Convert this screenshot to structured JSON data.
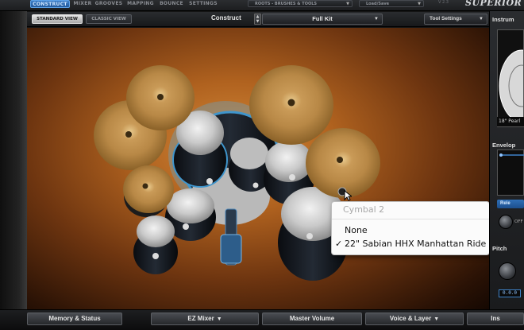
{
  "nav": {
    "tabs": [
      "CONSTRUCT",
      "MIXER",
      "GROOVES",
      "MAPPING",
      "BOUNCE",
      "SETTINGS"
    ],
    "presets_dropdown": "ROOTS - BRUSHES & TOOLS",
    "load_save": "Load/Save",
    "version": "V 2.3",
    "brand": "SUPERIOR"
  },
  "toolbar": {
    "view_tabs": [
      "STANDARD VIEW",
      "CLASSIC VIEW"
    ],
    "construct_label": "Construct",
    "kit_select": "Full Kit",
    "tool_settings": "Tool Settings"
  },
  "context_menu": {
    "title": "Cymbal 2",
    "items": [
      "None",
      "22\" Sabian HHX Manhattan Ride"
    ],
    "checked_index": 1,
    "check_mark": "✓"
  },
  "right_panel": {
    "instrument_header": "Instrum",
    "instrument_caption": "18\" Pearl",
    "envelope_header": "Envelop",
    "release_button": "Rele",
    "off_label": "OFF",
    "pitch_header": "Pitch",
    "pitch_value": "0.0.0"
  },
  "bottom_bar": {
    "tabs": [
      "Memory & Status",
      "EZ Mixer",
      "Master Volume",
      "Voice & Layer",
      "Ins"
    ],
    "arrow": "▼"
  },
  "colors": {
    "accent_blue": "#3d7fc9",
    "stage_wood": "#b0621f",
    "cymbal_bronze": "#c79a55"
  }
}
